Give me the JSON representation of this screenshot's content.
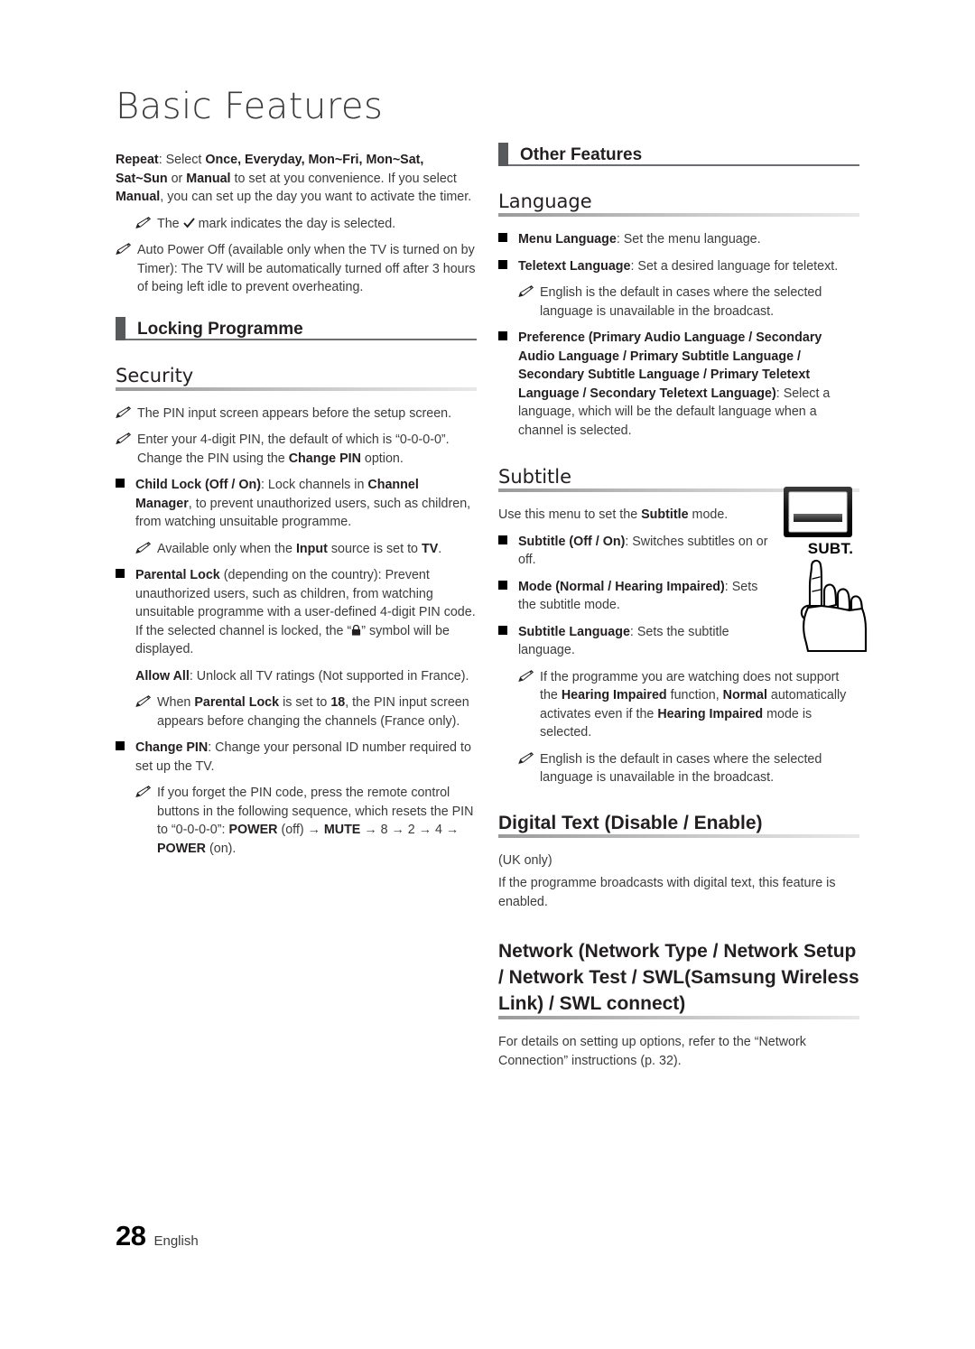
{
  "page": {
    "title": "Basic Features",
    "number": "28",
    "language": "English"
  },
  "icons": {
    "note": "note-pencil-icon",
    "square_bullet": "square-bullet-icon",
    "lock": "lock-icon",
    "check": "check-mark-icon",
    "subt_button": "subt-remote-button-icon",
    "hand": "pointing-hand-icon"
  },
  "colors": {
    "section_marker": "#58595b",
    "section_rule": "#6d6e71",
    "heading_rule_start": "#9a9a9a",
    "heading_rule_end": "#e8e8e8",
    "text": "#3b3b3b",
    "bold_text": "#231f20"
  },
  "left_column": {
    "repeat_para": {
      "label": "Repeat",
      "text_1": ": Select ",
      "options_1": "Once, Everyday, Mon~Fri, Mon~Sat, Sat~Sun",
      "text_2": " or ",
      "options_2": "Manual",
      "text_3": " to set at you convenience. If you select ",
      "options_3": "Manual",
      "text_4": ", you can set up the day you want to activate the timer."
    },
    "repeat_note": {
      "pre": "The ",
      "post": " mark indicates the day is selected."
    },
    "auto_power_off_note": "Auto Power Off (available only when the TV is turned on by Timer): The TV will be automatically turned off after 3 hours of being left idle to prevent overheating.",
    "section_heading": "Locking Programme",
    "security_heading": "Security",
    "security_note_1": "The PIN input screen appears before the setup screen.",
    "security_note_2": {
      "pre": "Enter your 4-digit PIN, the default of which is “0-0-0-0”. Change the PIN using the ",
      "bold": "Change PIN",
      "post": " option."
    },
    "child_lock": {
      "bold_1": "Child Lock (Off / On)",
      "text_1": ": Lock channels in ",
      "bold_2": "Channel Manager",
      "text_2": ", to prevent unauthorized users, such as children, from watching unsuitable programme."
    },
    "child_lock_note": {
      "pre": "Available only when the ",
      "bold_1": "Input",
      "mid": " source is set to ",
      "bold_2": "TV",
      "post": "."
    },
    "parental_lock": {
      "bold_1": "Parental Lock",
      "text_1": " (depending on the country): Prevent unauthorized users, such as children, from watching unsuitable programme with a user-defined 4-digit PIN code. If the selected channel is locked, the “",
      "text_2": "” symbol will be displayed."
    },
    "allow_all": {
      "bold": "Allow All",
      "text": ": Unlock all TV ratings (Not supported in France)."
    },
    "parental_lock_note": {
      "pre": "When ",
      "bold_1": "Parental Lock",
      "mid": " is set to ",
      "bold_2": "18",
      "post": ", the PIN input screen appears before changing the channels (France only)."
    },
    "change_pin": {
      "bold": "Change PIN",
      "text": ": Change your personal ID number required to set up the TV."
    },
    "change_pin_note": {
      "pre": "If you forget the PIN code, press the remote control buttons in the following sequence, which resets the PIN to “0-0-0-0”: ",
      "seq_1": "POWER",
      "seq_1_suffix": " (off) → ",
      "seq_2": "MUTE",
      "seq_2_suffix": " → 8 → 2 → 4 → ",
      "seq_3": "POWER",
      "seq_3_suffix": " (on)."
    }
  },
  "right_column": {
    "section_heading": "Other Features",
    "language_heading": "Language",
    "menu_language": {
      "bold": "Menu Language",
      "text": ": Set the menu language."
    },
    "teletext_language": {
      "bold": "Teletext Language",
      "text": ": Set a desired language for teletext."
    },
    "teletext_note": "English is the default in cases where the selected language is unavailable in the broadcast.",
    "preference": {
      "bold": "Preference (Primary Audio Language / Secondary Audio Language / Primary Subtitle Language / Secondary Subtitle Language / Primary Teletext Language / Secondary Teletext Language)",
      "text": ": Select a language, which will be the default language when a channel is selected."
    },
    "subtitle_heading": "Subtitle",
    "subtitle_intro": {
      "pre": "Use this menu to set the ",
      "bold": "Subtitle",
      "post": " mode."
    },
    "subtitle_onoff": {
      "bold": "Subtitle (Off / On)",
      "text": ": Switches subtitles on or off."
    },
    "subtitle_mode": {
      "bold": "Mode (Normal / Hearing Impaired)",
      "text": ": Sets the subtitle mode."
    },
    "subtitle_lang": {
      "bold": "Subtitle Language",
      "text": ": Sets the subtitle language."
    },
    "hearing_note": {
      "t1": "If the programme you are watching does not support the ",
      "b1": "Hearing Impaired",
      "t2": " function, ",
      "b2": "Normal",
      "t3": " automatically activates even if the ",
      "b3": "Hearing Impaired",
      "t4": " mode is selected."
    },
    "subtitle_english_note": "English is the default in cases where the selected language is unavailable in the broadcast.",
    "digital_text_heading": "Digital Text (Disable / Enable)",
    "digital_text_region": "(UK only)",
    "digital_text_body": "If the programme broadcasts with digital text, this feature is enabled.",
    "network_heading": "Network (Network Type / Network Setup / Network Test / SWL(Samsung Wireless Link) / SWL connect)",
    "network_body": "For details on setting up options, refer to the “Network Connection” instructions (p. 32).",
    "subt_button_label": "SUBT."
  }
}
